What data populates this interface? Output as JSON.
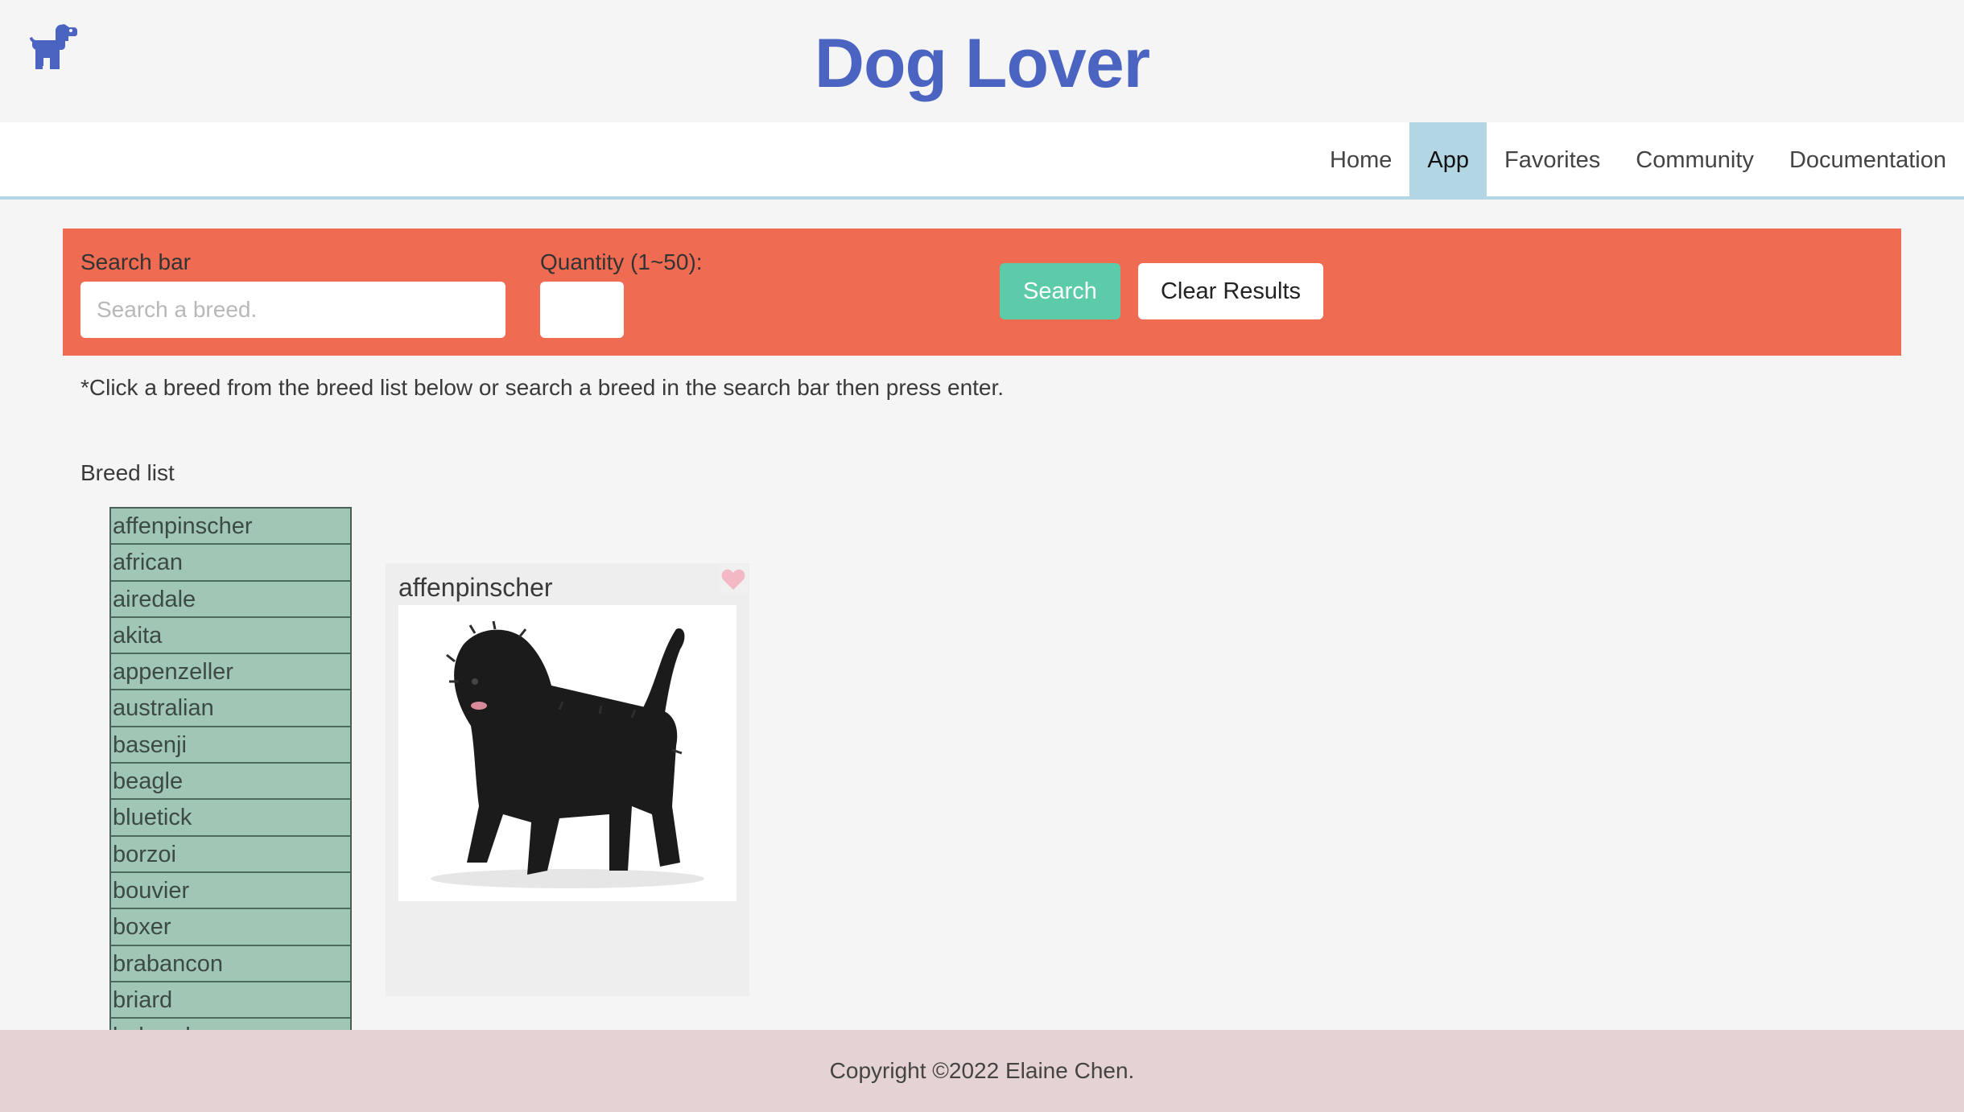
{
  "header": {
    "title": "Dog Lover",
    "logo_icon": "dog-icon"
  },
  "nav": {
    "items": [
      {
        "label": "Home",
        "active": false
      },
      {
        "label": "App",
        "active": true
      },
      {
        "label": "Favorites",
        "active": false
      },
      {
        "label": "Community",
        "active": false
      },
      {
        "label": "Documentation",
        "active": false
      }
    ]
  },
  "search": {
    "search_label": "Search bar",
    "search_placeholder": "Search a breed.",
    "search_value": "",
    "quantity_label": "Quantity (1~50):",
    "quantity_value": "",
    "search_button": "Search",
    "clear_button": "Clear Results"
  },
  "hint": "*Click a breed from the breed list below or search a breed in the search bar then press enter.",
  "breed_list": {
    "label": "Breed list",
    "items": [
      "affenpinscher",
      "african",
      "airedale",
      "akita",
      "appenzeller",
      "australian",
      "basenji",
      "beagle",
      "bluetick",
      "borzoi",
      "bouvier",
      "boxer",
      "brabancon",
      "briard",
      "buhund"
    ]
  },
  "results": [
    {
      "breed": "affenpinscher",
      "favorite_icon": "heart-icon"
    }
  ],
  "footer": {
    "copyright": "Copyright ©2022 Elaine Chen."
  },
  "colors": {
    "accent": "#4b64c2",
    "search_panel": "#ef6c52",
    "search_button": "#5bcbaa",
    "nav_active": "#b3d6e4",
    "breed_list_bg": "#a0c6b5",
    "footer_bg": "#e5d2d2",
    "heart": "#f2b8c4"
  }
}
